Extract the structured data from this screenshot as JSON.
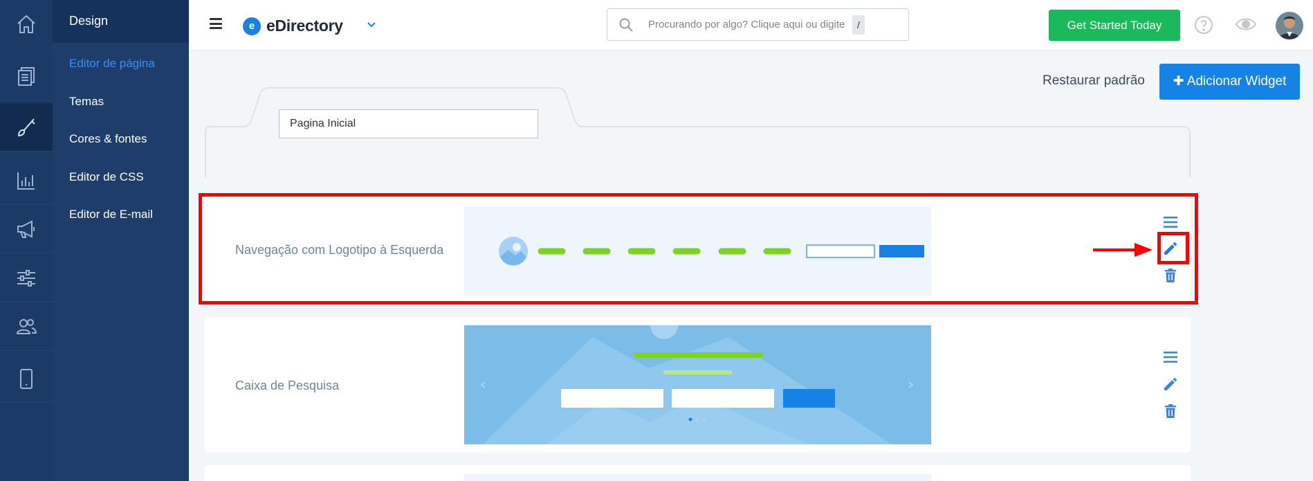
{
  "sidebar": {
    "rail_icons": [
      "home-icon",
      "pages-icon",
      "brush-icon",
      "chart-icon",
      "megaphone-icon",
      "sliders-icon",
      "users-icon",
      "mobile-icon"
    ],
    "section_title": "Design",
    "items": [
      {
        "label": "Editor de página",
        "active": true
      },
      {
        "label": "Temas"
      },
      {
        "label": "Cores & fontes"
      },
      {
        "label": "Editor de CSS"
      },
      {
        "label": "Editor de E-mail"
      }
    ]
  },
  "header": {
    "logo_letter": "e",
    "logo_text": "eDirectory",
    "search_placeholder": "Procurando por algo? Clique aqui ou digite",
    "search_shortcut": "/",
    "cta_label": "Get Started Today"
  },
  "main": {
    "restore_label": "Restaurar padrão",
    "add_widget_label": "Adicionar Widget",
    "page_name_value": "Pagina Inicial",
    "widgets": [
      {
        "label": "Navegação com Logotipo à Esquerda"
      },
      {
        "label": "Caixa de Pesquisa"
      }
    ]
  },
  "colors": {
    "accent": "#1682e6",
    "cta": "#1aba5c",
    "highlight": "#ff0000",
    "sidebar": "#1c3a66"
  }
}
